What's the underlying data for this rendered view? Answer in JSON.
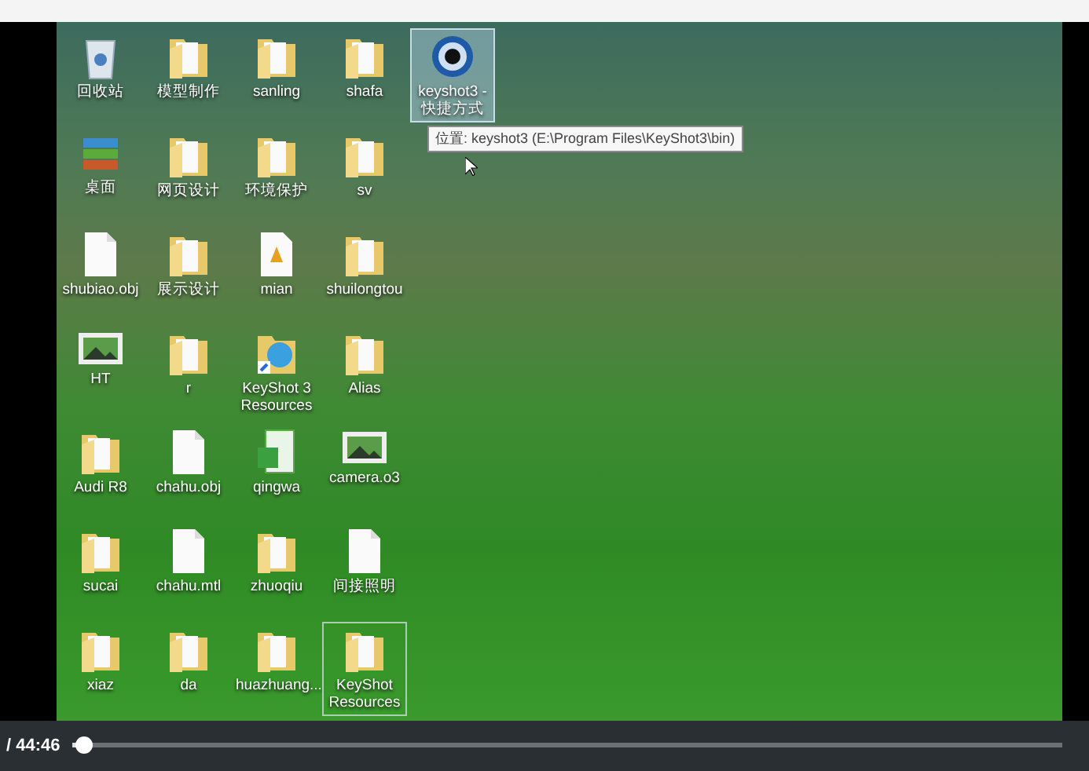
{
  "desktop": {
    "icons": [
      {
        "label": "回收站",
        "kind": "recycle",
        "selected": false,
        "focused": false
      },
      {
        "label": "桌面",
        "kind": "archive",
        "selected": false,
        "focused": false
      },
      {
        "label": "shubiao.obj",
        "kind": "file",
        "selected": false,
        "focused": false
      },
      {
        "label": "HT",
        "kind": "picture",
        "selected": false,
        "focused": false
      },
      {
        "label": "Audi R8",
        "kind": "folder",
        "selected": false,
        "focused": false
      },
      {
        "label": "sucai",
        "kind": "folder",
        "selected": false,
        "focused": false
      },
      {
        "label": "xiaz",
        "kind": "folder",
        "selected": false,
        "focused": false
      },
      {
        "label": "模型制作",
        "kind": "folder",
        "selected": false,
        "focused": false
      },
      {
        "label": "网页设计",
        "kind": "folder",
        "selected": false,
        "focused": false
      },
      {
        "label": "展示设计",
        "kind": "folder",
        "selected": false,
        "focused": false
      },
      {
        "label": "r",
        "kind": "folder",
        "selected": false,
        "focused": false
      },
      {
        "label": "chahu.obj",
        "kind": "file",
        "selected": false,
        "focused": false
      },
      {
        "label": "chahu.mtl",
        "kind": "file",
        "selected": false,
        "focused": false
      },
      {
        "label": "da",
        "kind": "folder",
        "selected": false,
        "focused": false
      },
      {
        "label": "sanling",
        "kind": "folder",
        "selected": false,
        "focused": false
      },
      {
        "label": "环境保护",
        "kind": "folder",
        "selected": false,
        "focused": false
      },
      {
        "label": "mian",
        "kind": "document",
        "selected": false,
        "focused": false
      },
      {
        "label": "KeyShot 3 Resources",
        "kind": "shortcut",
        "selected": false,
        "focused": false
      },
      {
        "label": "qingwa",
        "kind": "spreadsheet",
        "selected": false,
        "focused": false
      },
      {
        "label": "zhuoqiu",
        "kind": "folder",
        "selected": false,
        "focused": false
      },
      {
        "label": "huazhuang...",
        "kind": "folder",
        "selected": false,
        "focused": false
      },
      {
        "label": "shafa",
        "kind": "folder",
        "selected": false,
        "focused": false
      },
      {
        "label": "sv",
        "kind": "folder",
        "selected": false,
        "focused": false
      },
      {
        "label": "shuilongtou",
        "kind": "folder",
        "selected": false,
        "focused": false
      },
      {
        "label": "Alias",
        "kind": "folder",
        "selected": false,
        "focused": false
      },
      {
        "label": "camera.o3",
        "kind": "picture",
        "selected": false,
        "focused": false
      },
      {
        "label": "间接照明",
        "kind": "file",
        "selected": false,
        "focused": false
      },
      {
        "label": "KeyShot Resources",
        "kind": "folder",
        "selected": false,
        "focused": true
      },
      {
        "label": "keyshot3 - 快捷方式",
        "kind": "app",
        "selected": true,
        "focused": false
      }
    ],
    "tooltip": "位置: keyshot3 (E:\\Program Files\\KeyShot3\\bin)"
  },
  "player": {
    "time": "/ 44:46",
    "progress": {
      "level": 0.01
    }
  }
}
